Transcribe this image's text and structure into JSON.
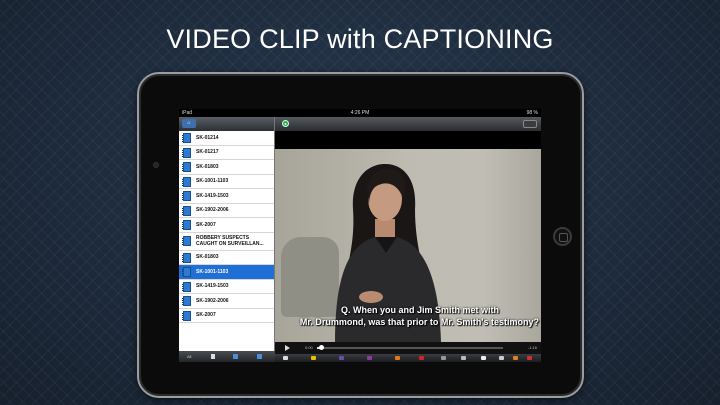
{
  "slide": {
    "title": "VIDEO CLIP with CAPTIONING"
  },
  "status_bar": {
    "carrier": "iPad",
    "time": "4:26 PM",
    "battery": "98 %"
  },
  "sidebar": {
    "back_label": "⌂",
    "items": [
      {
        "label": "SK-01214",
        "selected": false
      },
      {
        "label": "SK-01217",
        "selected": false
      },
      {
        "label": "SK-01803",
        "selected": false
      },
      {
        "label": "SK-1001-1103",
        "selected": false
      },
      {
        "label": "SK-1419-1503",
        "selected": false
      },
      {
        "label": "SK-1902-2006",
        "selected": false
      },
      {
        "label": "SK-2007",
        "selected": false
      },
      {
        "label": "ROBBERY SUSPECTS\nCAUGHT ON SURVEILLAN...",
        "selected": false
      },
      {
        "label": "SK-01803",
        "selected": false
      },
      {
        "label": "SK-1001-1103",
        "selected": true
      },
      {
        "label": "SK-1419-1503",
        "selected": false
      },
      {
        "label": "SK-1902-2006",
        "selected": false
      },
      {
        "label": "SK-2007",
        "selected": false
      }
    ],
    "footer_label": "All"
  },
  "player": {
    "caption_line1": "Q.   When you and Jim Smith met with",
    "caption_line2": "Mr. Drummond, was that prior to Mr. Smith's testimony?",
    "time_elapsed": "0:00",
    "time_remaining": "-1:16",
    "progress": 0.02
  },
  "colors": {
    "selected_row": "#1f6fd6",
    "doc_icon": "#2c7bd0",
    "toolbar_accent": "#2eaa4a"
  }
}
